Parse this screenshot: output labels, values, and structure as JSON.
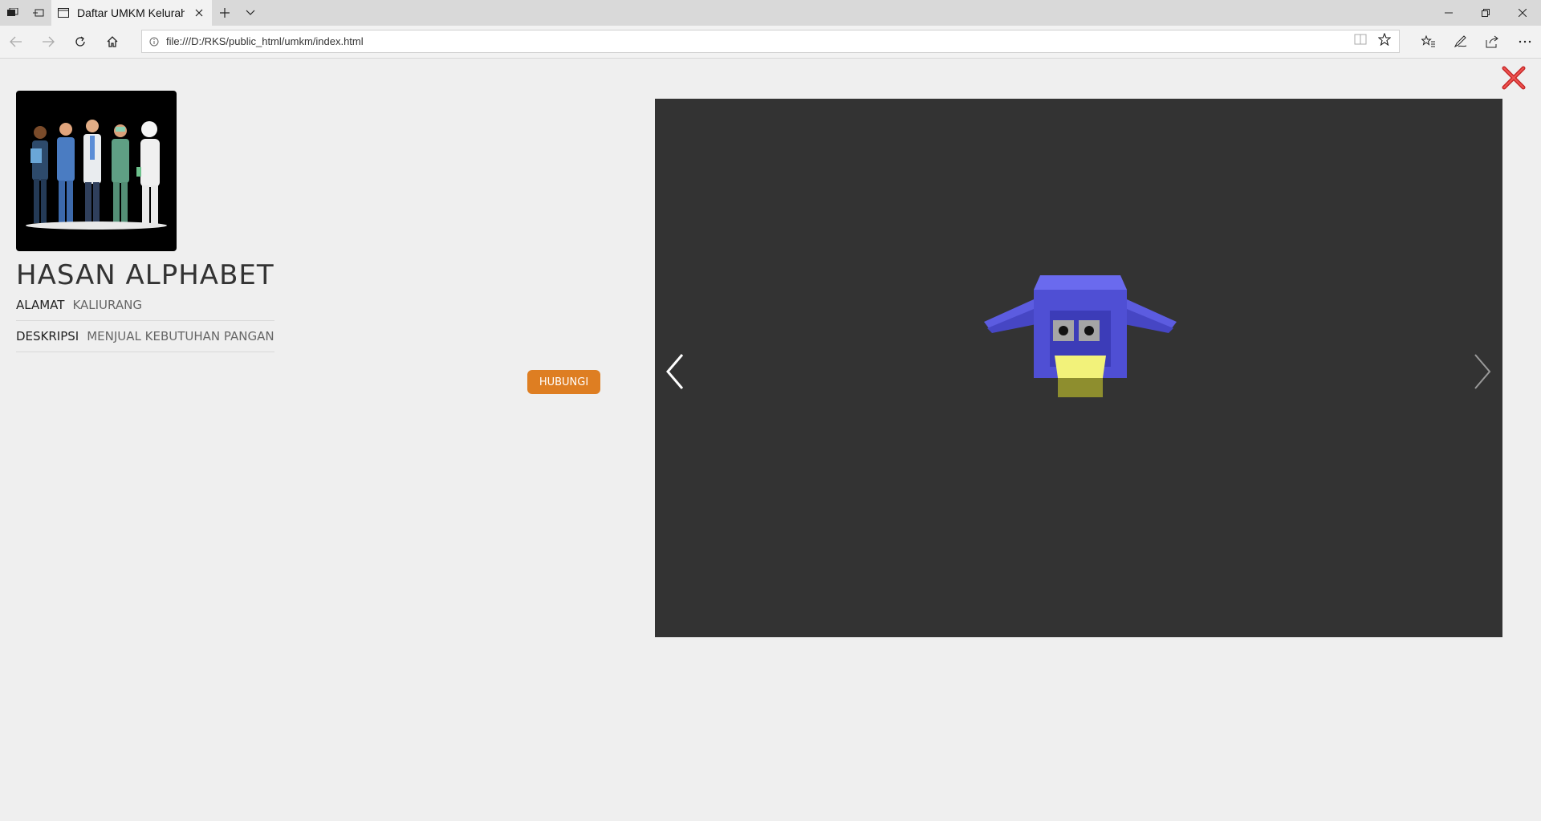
{
  "browser": {
    "tab_title": "Daftar UMKM Kelurahan",
    "url": "file:///D:/RKS/public_html/umkm/index.html"
  },
  "profile": {
    "name": "HASAN ALPHABET",
    "alamat_label": "ALAMAT",
    "alamat_value": "KALIURANG",
    "deskripsi_label": "DESKRIPSI",
    "deskripsi_value": "MENJUAL KEBUTUHAN PANGAN",
    "contact_button": "HUBUNGI"
  },
  "colors": {
    "accent": "#de7e22",
    "viewer_bg": "#333333",
    "close": "#d32f2f"
  }
}
